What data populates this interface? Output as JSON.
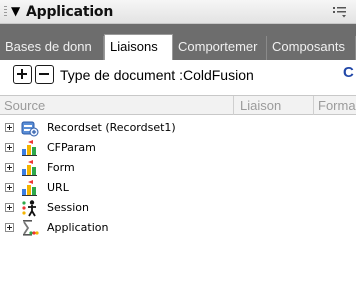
{
  "panel": {
    "title": "Application",
    "collapse_icon": "triangle-down-icon",
    "options_icon": "panel-options-icon"
  },
  "tabs": [
    {
      "label": "Bases de donn",
      "active": false
    },
    {
      "label": "Liaisons",
      "active": true
    },
    {
      "label": "Comportemer",
      "active": false
    },
    {
      "label": "Composants",
      "active": false
    }
  ],
  "toolbar": {
    "add_icon": "plus-icon",
    "remove_icon": "minus-icon",
    "document_type": "Type de document :ColdFusion",
    "refresh_label": "C"
  },
  "columns": [
    "Source",
    "Liaison",
    "Forma"
  ],
  "tree": [
    {
      "label": "Recordset (Recordset1)",
      "icon": "recordset-icon"
    },
    {
      "label": "CFParam",
      "icon": "cfparam-icon"
    },
    {
      "label": "Form",
      "icon": "form-icon"
    },
    {
      "label": "URL",
      "icon": "url-icon"
    },
    {
      "label": "Session",
      "icon": "session-icon"
    },
    {
      "label": "Application",
      "icon": "application-icon"
    }
  ],
  "colors": {
    "tabstrip_bg": "#6d6d6d",
    "refresh_blue": "#2248a8"
  }
}
